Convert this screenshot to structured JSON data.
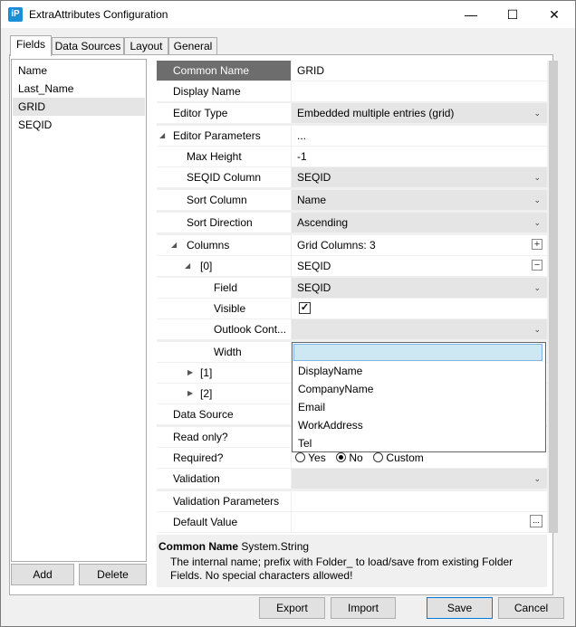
{
  "window": {
    "title": "ExtraAttributes Configuration",
    "app_icon": "iP",
    "controls": {
      "minimize": "—",
      "maximize": "☐",
      "close": "✕"
    }
  },
  "tabs": [
    "Fields",
    "Data Sources",
    "Layout",
    "General"
  ],
  "fields": {
    "items": [
      "Name",
      "Last_Name",
      "GRID",
      "SEQID"
    ],
    "selected": "GRID",
    "add_label": "Add",
    "delete_label": "Delete"
  },
  "properties": {
    "common_name": {
      "label": "Common Name",
      "value": "GRID"
    },
    "display_name": {
      "label": "Display Name",
      "value": ""
    },
    "editor_type": {
      "label": "Editor Type",
      "value": "Embedded multiple entries (grid)"
    },
    "editor_parameters": {
      "label": "Editor Parameters",
      "value": "..."
    },
    "max_height": {
      "label": "Max Height",
      "value": "-1"
    },
    "seqid_column": {
      "label": "SEQID Column",
      "value": "SEQID"
    },
    "sort_column": {
      "label": "Sort Column",
      "value": "Name"
    },
    "sort_direction": {
      "label": "Sort Direction",
      "value": "Ascending"
    },
    "columns": {
      "label": "Columns",
      "value": "Grid Columns: 3"
    },
    "col0": {
      "label": "[0]",
      "value": "SEQID"
    },
    "field": {
      "label": "Field",
      "value": "SEQID"
    },
    "visible": {
      "label": "Visible",
      "checked": true,
      "mark": "✓"
    },
    "outlook_contact": {
      "label": "Outlook Cont...",
      "value": ""
    },
    "width": {
      "label": "Width",
      "value": ""
    },
    "col1": {
      "label": "[1]"
    },
    "col2": {
      "label": "[2]"
    },
    "data_source": {
      "label": "Data Source"
    },
    "read_only": {
      "label": "Read only?"
    },
    "required": {
      "label": "Required?",
      "options": [
        "Yes",
        "No",
        "Custom"
      ],
      "selected": "No"
    },
    "validation": {
      "label": "Validation",
      "value": ""
    },
    "validation_parameters": {
      "label": "Validation Parameters",
      "value": ""
    },
    "default_value": {
      "label": "Default Value",
      "value": "",
      "button": "..."
    }
  },
  "dropdown": {
    "options": [
      "DisplayName",
      "CompanyName",
      "Email",
      "WorkAddress",
      "Tel"
    ]
  },
  "description": {
    "title": "Common Name",
    "type": "System.String",
    "text": "The internal name; prefix with Folder_ to load/save from existing Folder Fields. No special characters allowed!"
  },
  "footer": {
    "export_label": "Export",
    "import_label": "Import",
    "save_label": "Save",
    "cancel_label": "Cancel"
  },
  "icons": {
    "chevron": "⌄",
    "expanded": "◢",
    "collapsed": "▶",
    "plus": "+",
    "minus": "−"
  }
}
